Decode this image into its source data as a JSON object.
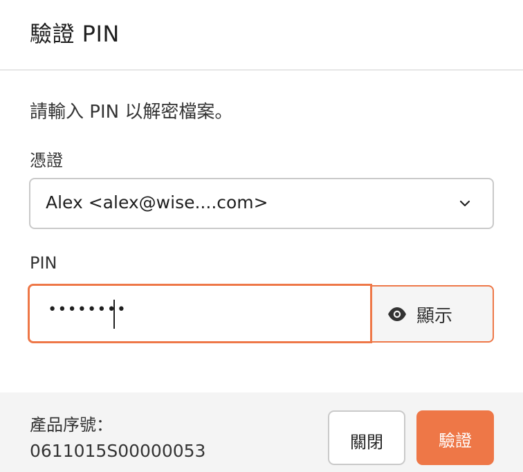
{
  "dialog": {
    "title": "驗證 PIN",
    "prompt": "請輸入 PIN 以解密檔案。"
  },
  "credential": {
    "label": "憑證",
    "selected": "Alex <alex@wise....com>",
    "icon": "chevron-down-icon"
  },
  "pin": {
    "label": "PIN",
    "masked_value": "••••••••",
    "focused": true,
    "show_button": {
      "label": "顯示",
      "icon": "eye-icon"
    }
  },
  "footer": {
    "serial_label": "產品序號：",
    "serial_value": "0611015S00000053",
    "close_label": "關閉",
    "verify_label": "驗證"
  },
  "colors": {
    "accent": "#ee7747",
    "footer_bg": "#f4f4f4",
    "border": "#c9c9c9"
  }
}
